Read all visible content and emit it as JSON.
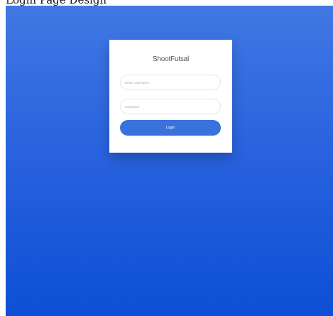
{
  "page_heading": "Login Page Design",
  "app": {
    "title": "ShootFutsal"
  },
  "form": {
    "username_placeholder": "Enter Username...",
    "password_placeholder": "Password",
    "login_label": "Login"
  },
  "colors": {
    "background_top": "#4078e3",
    "background_bottom": "#0d4fd6",
    "card": "#ffffff",
    "button": "#3a72dd"
  }
}
